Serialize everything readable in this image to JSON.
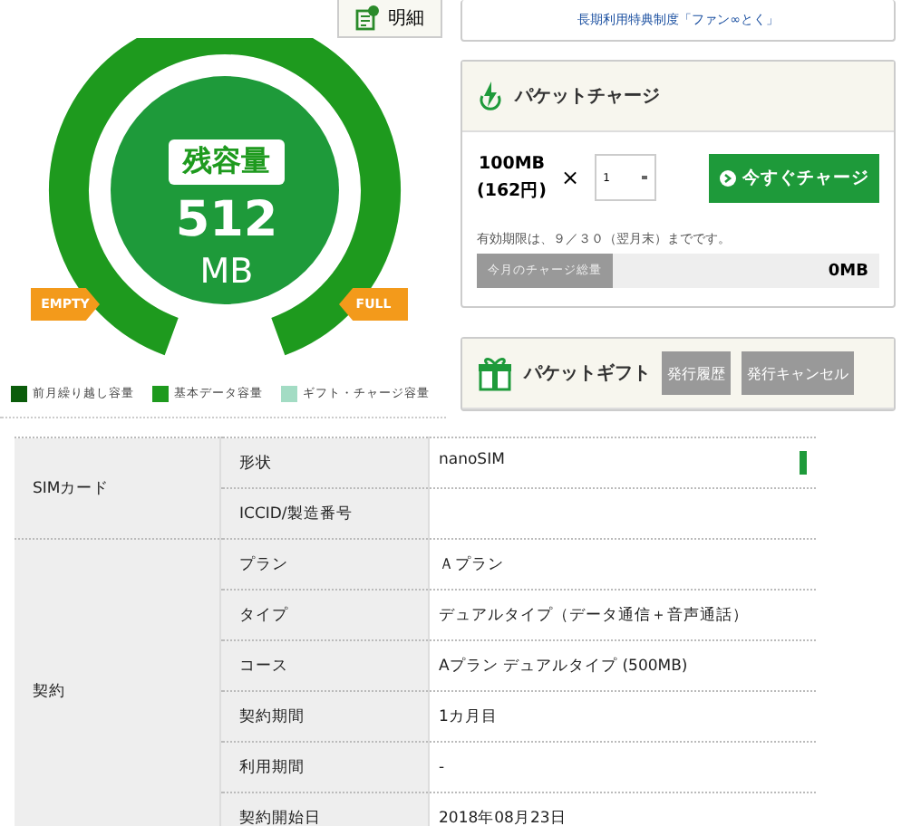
{
  "detail_button": {
    "label": "明細"
  },
  "gauge": {
    "title": "残容量",
    "value": "512",
    "unit": "MB",
    "level": 1,
    "empty_label": "EMPTY",
    "full_label": "FULL"
  },
  "legend": [
    {
      "label": "前月繰り越し容量",
      "color": "#0b5c0b"
    },
    {
      "label": "基本データ容量",
      "color": "#1e9a1e"
    },
    {
      "label": "ギフト・チャージ容量",
      "color": "#a3dcc4"
    }
  ],
  "benefit_link": {
    "label": "長期利用特典制度「ファン∞とく」"
  },
  "charge": {
    "title": "パケットチャージ",
    "amount": "100MB",
    "price": "(162円)",
    "times": "×",
    "quantity": "1",
    "button": "今すぐチャージ",
    "note": "有効期限は、９／３０（翌月末）までです。",
    "total_label": "今月のチャージ総量",
    "total_value": "0MB"
  },
  "gift": {
    "title": "パケットギフト",
    "buttons": [
      "発行履歴",
      "発行キャンセル"
    ]
  },
  "table": {
    "groups": [
      {
        "label": "SIMカード",
        "rows": [
          {
            "label": "形状",
            "value": "nanoSIM"
          },
          {
            "label": "ICCID/製造番号",
            "value": ""
          }
        ]
      },
      {
        "label": "契約",
        "rows": [
          {
            "label": "プラン",
            "value": "Ａプラン"
          },
          {
            "label": "タイプ",
            "value": "デュアルタイプ（データ通信＋音声通話）"
          },
          {
            "label": "コース",
            "value": "Aプラン デュアルタイプ (500MB)"
          },
          {
            "label": "契約期間",
            "value": "1カ月目"
          },
          {
            "label": "利用期間",
            "value": "-"
          },
          {
            "label": "契約開始日",
            "value": "2018年08月23日"
          }
        ]
      }
    ]
  }
}
